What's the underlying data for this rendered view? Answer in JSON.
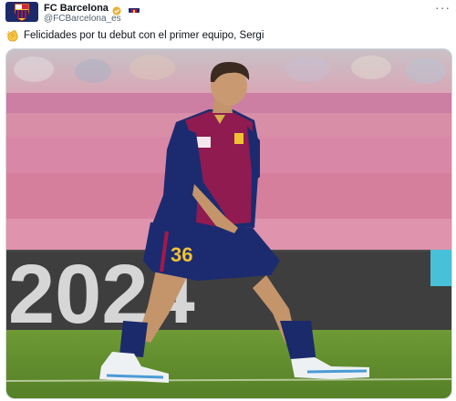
{
  "tweet": {
    "author": {
      "display_name": "FC Barcelona",
      "handle": "@FCBarcelona_es",
      "verified_icon": "gold-verified-badge-icon",
      "flag_icon": "spain-flag-icon"
    },
    "more_label": "···",
    "text": "Felicidades por tu debut con el primer equipo, Sergi",
    "text_emoji": "clapping-hands-icon",
    "media": {
      "board_text": "2024",
      "shirt_number": "36"
    }
  },
  "colors": {
    "handle_gray": "#536471",
    "barca_blue": "#1b2a6b",
    "barca_garnet": "#a5194a",
    "gold": "#e8b33b",
    "pitch_green": "#5e8a2c"
  }
}
